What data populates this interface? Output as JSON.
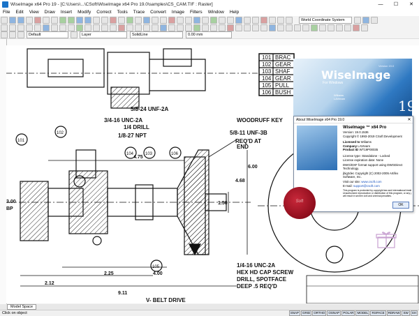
{
  "window": {
    "title": "WiseImage x64 Pro 19 - [C:\\Users\\...\\CSoft\\WiseImage x64 Pro 19.0\\samples\\CS_CAM.TIF : Raster]",
    "minimize": "—",
    "maximize": "☐",
    "close": "✕"
  },
  "menu": [
    "File",
    "Edit",
    "View",
    "Draw",
    "Insert",
    "Modify",
    "Correct",
    "Tools",
    "Trace",
    "Convert",
    "Image",
    "Filters",
    "Window",
    "Help"
  ],
  "toolbar": {
    "coord_system": "World Coordinate System",
    "layer_value": "Default",
    "layer_label": "Layer",
    "linetype": "SolidLine",
    "lineweight": "0.00 mm"
  },
  "splash": {
    "brand": "WiseImage",
    "version_tag": "Version 19.0",
    "for_windows": "For Windows",
    "watermark1": "Wiliams",
    "watermark2": "LAVteam",
    "big_number": "19"
  },
  "about": {
    "title": "About WiseImage x64 Pro 19.0",
    "close": "✕",
    "product": "WiseImage ™ x64 Pro",
    "version": "Version: 19.0.1536",
    "copyright": "Copyright © 1993-2019 CSoft Development",
    "licensed_to_label": "Licensed to",
    "licensed_to": "Wiliams",
    "company_label": "Company",
    "company": "LAVteam",
    "product_id_label": "Product ID",
    "product_id": "WT19P00035",
    "license_type": "License type: Standalone - Locked",
    "license_exp": "License expiration date: None",
    "dwg": "DWG/DXF format support using DWGDirect Technology.",
    "jbig": "jbig2dec Copyright (C) 2002-2005 Artifex Software, Inc.",
    "visit_label": "Visit our site:",
    "site": "www.csoft.com",
    "email_label": "E-mail:",
    "email": "support@csoft.com",
    "notice1": "This program is protected by copyright law and international treaties.",
    "notice2": "Unauthorized reproduction or distribution of this program, or any portion of it,",
    "notice3": "will result in severe civil and criminal penalties.",
    "ok": "OK"
  },
  "tabs": {
    "model": "Model Space"
  },
  "status": {
    "text": "Click on object",
    "buttons": [
      "SNAP",
      "GRID",
      "ORTHO",
      "OSNAP",
      "POLAR",
      "MODEL",
      "RSPACE",
      "RDRAW",
      "SW",
      "SH"
    ]
  },
  "drawing": {
    "table_rows": [
      {
        "no": "101",
        "name": "BRAC"
      },
      {
        "no": "102",
        "name": "GEAR"
      },
      {
        "no": "103",
        "name": "SHAF"
      },
      {
        "no": "104",
        "name": "GEAR"
      },
      {
        "no": "105",
        "name": "PULL"
      },
      {
        "no": "106",
        "name": "BUSH"
      }
    ],
    "notes": {
      "n1": "5/8-24 UNF-2A",
      "n2": "3/4-16 UNC-2A",
      "n3": "1/4 DRILL",
      "n4": "1/8-27 NPT",
      "n5": "WOODRUFF KEY",
      "n6": "5/8-11 UNF-3B",
      "n7": "REQ'D AT",
      "n8": "END",
      "n9": "1/4-16 UNC-2A",
      "n10": "HEX HD CAP SCREW",
      "n11": "DRILL, SPOTFACE",
      "n12": "DEEP .5 REQ'D"
    },
    "dims": {
      "d475": "4.75",
      "d600": "6.00",
      "d468": "4.68",
      "d150": "1.50",
      "d300": "3.00",
      "bp": "BP",
      "d212": "2.12",
      "d225": "2.25",
      "d400": "4.00",
      "d911": "9.11"
    },
    "labels": [
      "102",
      "104",
      "103",
      "106",
      "101",
      "105"
    ],
    "caption": "V- BELT DRIVE",
    "seal_text": "Soft"
  }
}
